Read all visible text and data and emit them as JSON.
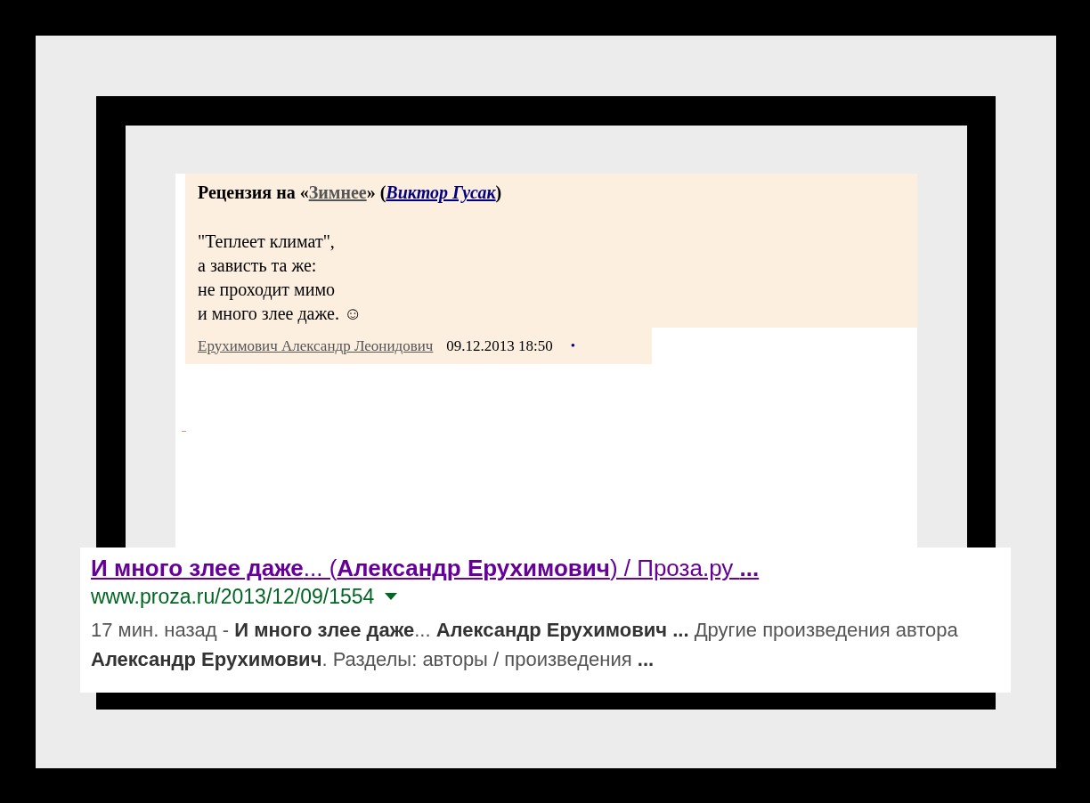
{
  "review": {
    "heading": {
      "prefix": "Рецензия на «",
      "work_link": "Зимнее",
      "middle": "» (",
      "author_link": "Виктор Гусак",
      "suffix": ")"
    },
    "poem": [
      "\"Теплеет климат\",",
      "а зависть та же:",
      "не проходит мимо",
      "и много злее даже. ☺"
    ],
    "footer": {
      "author": "Ерухимович Александр Леонидович",
      "date": "09.12.2013 18:50",
      "bullet": "•"
    }
  },
  "search_result": {
    "title": "**И много злее даже**... (**Александр Ерухимович**) / Проза.ру **...**",
    "url": "www.proza.ru/2013/12/09/1554",
    "snippet": "17 мин. назад - **И много злее даже**... **Александр Ерухимович ...** Другие произведения автора **Александр Ерухимович**. Разделы: авторы / произведения **...**"
  }
}
